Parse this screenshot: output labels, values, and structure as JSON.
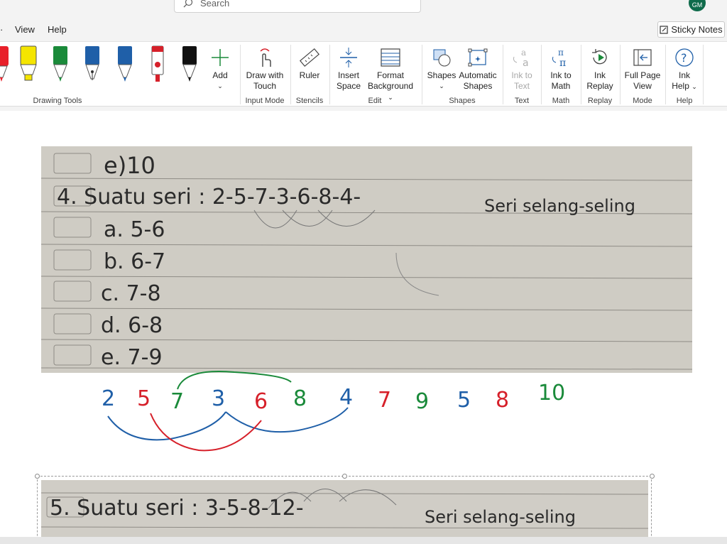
{
  "search": {
    "placeholder": "Search"
  },
  "user": {
    "initials": "GM"
  },
  "menu": {
    "view": "View",
    "help": "Help"
  },
  "sticky_notes": "Sticky Notes",
  "ribbon": {
    "add": "Add",
    "draw_with_touch": [
      "Draw with",
      "Touch"
    ],
    "ruler": "Ruler",
    "insert_space": [
      "Insert",
      "Space"
    ],
    "format_background": [
      "Format",
      "Background"
    ],
    "shapes": "Shapes",
    "automatic_shapes": [
      "Automatic",
      "Shapes"
    ],
    "ink_to_text": [
      "Ink to",
      "Text"
    ],
    "ink_to_math": [
      "Ink to",
      "Math"
    ],
    "ink_replay": [
      "Ink",
      "Replay"
    ],
    "full_page_view": [
      "Full Page",
      "View"
    ],
    "ink_help": [
      "Ink",
      "Help"
    ],
    "groups": {
      "drawing_tools": "Drawing Tools",
      "input_mode": "Input Mode",
      "stencils": "Stencils",
      "edit": "Edit",
      "shapes": "Shapes",
      "text": "Text",
      "math": "Math",
      "replay": "Replay",
      "mode": "Mode",
      "help": "Help"
    }
  },
  "pens": [
    {
      "name": "red-pen",
      "color": "#e8202a"
    },
    {
      "name": "yellow-highlighter",
      "color": "#f5e500"
    },
    {
      "name": "green-pen",
      "color": "#1a8a3a"
    },
    {
      "name": "blue-fountain-pen",
      "color": "#1f5fa8"
    },
    {
      "name": "blue-pen",
      "color": "#1f5fa8"
    },
    {
      "name": "red-marker",
      "color": "#d6202a"
    },
    {
      "name": "black-pen",
      "color": "#111111"
    }
  ],
  "photo_text": {
    "line1": "e)10",
    "line2": "4. Suatu seri : 2-5-7-3-6-8-4-",
    "line2b": "Seri selang-seling",
    "a": "a. 5-6",
    "b": "b. 6-7",
    "c": "c. 7-8",
    "d": "d. 6-8",
    "e": "e. 7-9",
    "photo2_line": "5. Suatu seri : 3-5-8-12-",
    "photo2_tail": "Seri selang-seling"
  },
  "ink_numbers": [
    {
      "text": "2",
      "color": "#1f5fa8"
    },
    {
      "text": "5",
      "color": "#d6202a"
    },
    {
      "text": "7",
      "color": "#1a8a3a"
    },
    {
      "text": "3",
      "color": "#1f5fa8"
    },
    {
      "text": "6",
      "color": "#d6202a"
    },
    {
      "text": "8",
      "color": "#1a8a3a"
    },
    {
      "text": "4",
      "color": "#1f5fa8"
    },
    {
      "text": "7",
      "color": "#d6202a"
    },
    {
      "text": "9",
      "color": "#1a8a3a"
    },
    {
      "text": "5",
      "color": "#1f5fa8"
    },
    {
      "text": "8",
      "color": "#d6202a"
    },
    {
      "text": "10",
      "color": "#1a8a3a"
    }
  ]
}
